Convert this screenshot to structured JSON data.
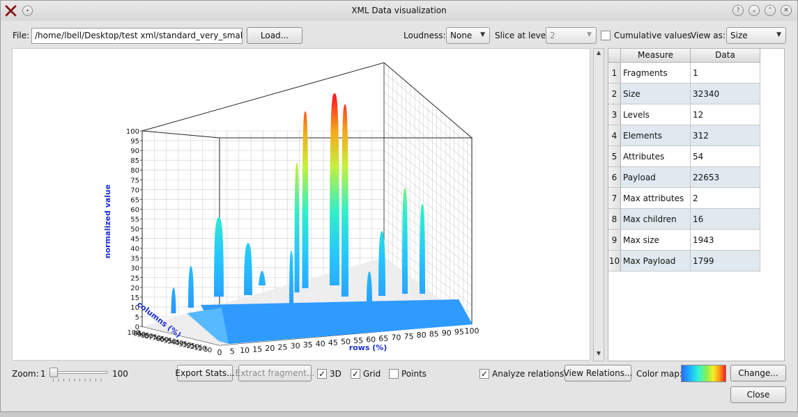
{
  "window": {
    "title": "XML Data visualization"
  },
  "file": {
    "label": "File:",
    "path": "/home/lbell/Desktop/test xml/standard_very_small..xml",
    "load": "Load..."
  },
  "controls": {
    "loudness_label": "Loudness:",
    "loudness_value": "None",
    "slice_label": "Slice at level:",
    "slice_value": "2",
    "cumulative_label": "Cumulative values",
    "cumulative_checked": false,
    "viewas_label": "View as:",
    "viewas_value": "Size"
  },
  "plot": {
    "zlabel": "normalized value",
    "xlabel": "rows (%)",
    "ylabel": "columns (%)",
    "z_ticks": [
      "0",
      "5",
      "10",
      "15",
      "20",
      "25",
      "30",
      "35",
      "40",
      "45",
      "50",
      "55",
      "60",
      "65",
      "70",
      "75",
      "80",
      "85",
      "90",
      "95",
      "100"
    ],
    "x_ticks": [
      "0",
      "5",
      "10",
      "15",
      "20",
      "25",
      "30",
      "35",
      "40",
      "45",
      "50",
      "55",
      "60",
      "65",
      "70",
      "75",
      "80",
      "85",
      "90",
      "95",
      "100"
    ],
    "y_ticks": [
      "100",
      "95",
      "90",
      "85",
      "80",
      "75",
      "70",
      "65",
      "60",
      "55",
      "50",
      "45",
      "40",
      "35",
      "30",
      "25",
      "20",
      "15",
      "10",
      "5",
      "0"
    ]
  },
  "table": {
    "headers": [
      "Measure",
      "Data"
    ],
    "rows": [
      {
        "n": "1",
        "measure": "Fragments",
        "data": "1"
      },
      {
        "n": "2",
        "measure": "Size",
        "data": "32340"
      },
      {
        "n": "3",
        "measure": "Levels",
        "data": "12"
      },
      {
        "n": "4",
        "measure": "Elements",
        "data": "312"
      },
      {
        "n": "5",
        "measure": "Attributes",
        "data": "54"
      },
      {
        "n": "6",
        "measure": "Payload",
        "data": "22653"
      },
      {
        "n": "7",
        "measure": "Max attributes",
        "data": "2"
      },
      {
        "n": "8",
        "measure": "Max children",
        "data": "16"
      },
      {
        "n": "9",
        "measure": "Max size",
        "data": "1943"
      },
      {
        "n": "10",
        "measure": "Max Payload",
        "data": "1799"
      }
    ]
  },
  "bottom": {
    "zoom_label": "Zoom:",
    "zoom_min": "1",
    "zoom_max": "100",
    "zoom_value": 0,
    "export": "Export Stats...",
    "extract": "Extract fragment...",
    "opt_3d": "3D",
    "opt_3d_checked": true,
    "opt_grid": "Grid",
    "opt_grid_checked": true,
    "opt_points": "Points",
    "opt_points_checked": false,
    "analyze": "Analyze relations",
    "analyze_checked": true,
    "view_relations": "View Relations...",
    "colormap_label": "Color map:",
    "change": "Change...",
    "close": "Close"
  },
  "colors": {
    "axis_label": "#1a2fd0",
    "row_alt": "#dfe9ef"
  }
}
